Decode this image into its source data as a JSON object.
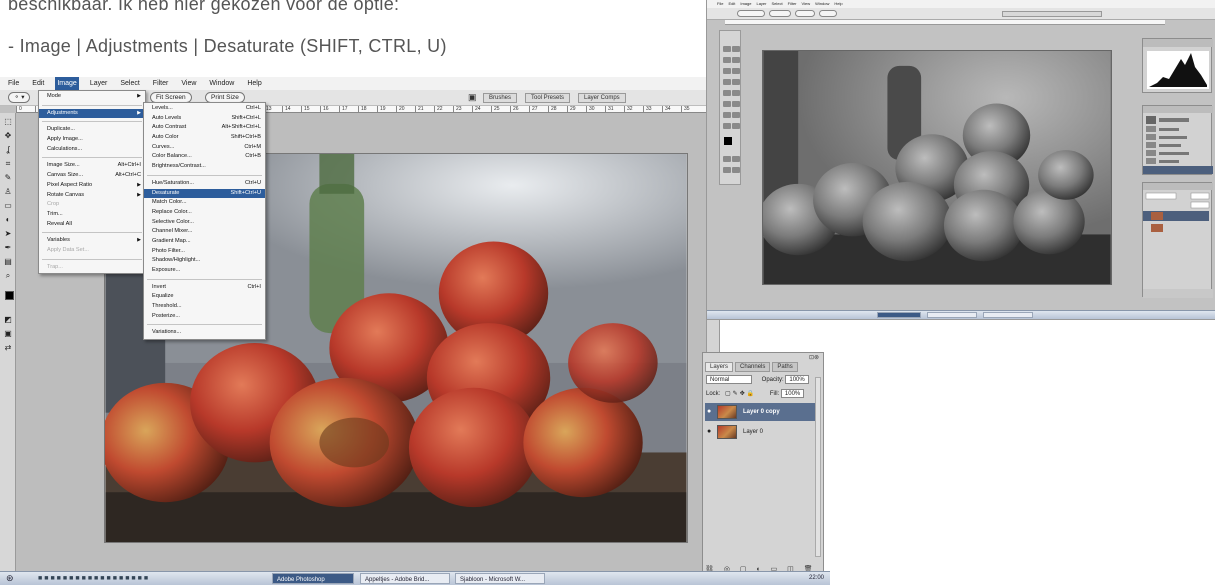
{
  "document": {
    "line1": "beschikbaar. Ik heb hier gekozen voor de optie:",
    "line2": "- Image | Adjustments | Desaturate (SHIFT, CTRL, U)"
  },
  "photoshop": {
    "menubar": [
      "File",
      "Edit",
      "Image",
      "Layer",
      "Select",
      "Filter",
      "View",
      "Window",
      "Help"
    ],
    "active_menu": "Image",
    "options_bar": {
      "fit_screen": "Fit Screen",
      "print_size": "Print Size"
    },
    "palette_tabs": [
      "Brushes",
      "Tool Presets",
      "Layer Comps"
    ],
    "ruler_ticks": [
      "0",
      "1",
      "2",
      "3",
      "4",
      "5",
      "6",
      "7",
      "8",
      "9",
      "10",
      "11",
      "12",
      "13",
      "14",
      "15",
      "16",
      "17",
      "18",
      "19",
      "20",
      "21",
      "22",
      "23",
      "24",
      "25",
      "26",
      "27",
      "28",
      "29",
      "30",
      "31",
      "32",
      "33",
      "34",
      "35"
    ],
    "image_menu": [
      {
        "label": "Mode",
        "arrow": true
      },
      {
        "sep": true
      },
      {
        "label": "Adjustments",
        "arrow": true,
        "highlight": true
      },
      {
        "sep": true
      },
      {
        "label": "Duplicate..."
      },
      {
        "label": "Apply Image..."
      },
      {
        "label": "Calculations..."
      },
      {
        "sep": true
      },
      {
        "label": "Image Size...",
        "shortcut": "Alt+Ctrl+I"
      },
      {
        "label": "Canvas Size...",
        "shortcut": "Alt+Ctrl+C"
      },
      {
        "label": "Pixel Aspect Ratio",
        "arrow": true
      },
      {
        "label": "Rotate Canvas",
        "arrow": true
      },
      {
        "label": "Crop",
        "disabled": true
      },
      {
        "label": "Trim..."
      },
      {
        "label": "Reveal All"
      },
      {
        "sep": true
      },
      {
        "label": "Variables",
        "arrow": true
      },
      {
        "label": "Apply Data Set...",
        "disabled": true
      },
      {
        "sep": true
      },
      {
        "label": "Trap...",
        "disabled": true
      }
    ],
    "adjustments_menu": [
      {
        "label": "Levels...",
        "shortcut": "Ctrl+L"
      },
      {
        "label": "Auto Levels",
        "shortcut": "Shift+Ctrl+L"
      },
      {
        "label": "Auto Contrast",
        "shortcut": "Alt+Shift+Ctrl+L"
      },
      {
        "label": "Auto Color",
        "shortcut": "Shift+Ctrl+B"
      },
      {
        "label": "Curves...",
        "shortcut": "Ctrl+M"
      },
      {
        "label": "Color Balance...",
        "shortcut": "Ctrl+B"
      },
      {
        "label": "Brightness/Contrast..."
      },
      {
        "sep": true
      },
      {
        "label": "Hue/Saturation...",
        "shortcut": "Ctrl+U"
      },
      {
        "label": "Desaturate",
        "shortcut": "Shift+Ctrl+U",
        "highlight": true
      },
      {
        "label": "Match Color..."
      },
      {
        "label": "Replace Color..."
      },
      {
        "label": "Selective Color..."
      },
      {
        "label": "Channel Mixer..."
      },
      {
        "label": "Gradient Map..."
      },
      {
        "label": "Photo Filter..."
      },
      {
        "label": "Shadow/Highlight..."
      },
      {
        "label": "Exposure..."
      },
      {
        "sep": true
      },
      {
        "label": "Invert",
        "shortcut": "Ctrl+I"
      },
      {
        "label": "Equalize"
      },
      {
        "label": "Threshold..."
      },
      {
        "label": "Posterize..."
      },
      {
        "sep": true
      },
      {
        "label": "Variations..."
      }
    ],
    "layers_panel": {
      "tabs": [
        "Layers",
        "Channels",
        "Paths"
      ],
      "blend_mode": "Normal",
      "opacity_label": "Opacity:",
      "opacity_value": "100%",
      "lock_label": "Lock:",
      "fill_label": "Fill:",
      "fill_value": "100%",
      "layers": [
        {
          "name": "Layer 0 copy",
          "selected": true
        },
        {
          "name": "Layer 0",
          "selected": false
        }
      ]
    },
    "taskbar": {
      "tasks": [
        "Adobe Photoshop",
        "Appeltjes - Adobe Brid...",
        "Sjabloon - Microsoft W..."
      ],
      "clock": "22:00"
    }
  },
  "colors": {
    "menu_highlight": "#2d5d9c",
    "selected_layer": "#5a6f8f",
    "taskbar_active": "#3c5a86"
  }
}
